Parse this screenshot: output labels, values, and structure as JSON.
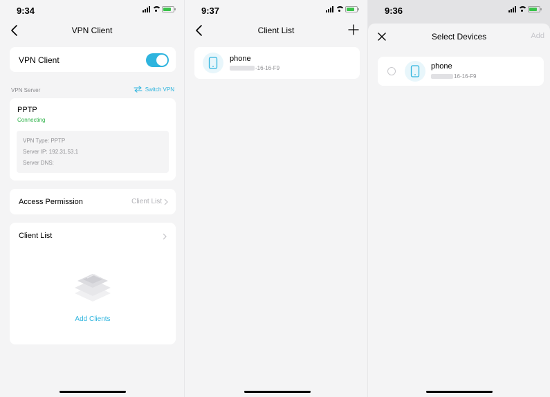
{
  "screen1": {
    "status_time": "9:34",
    "nav_title": "VPN Client",
    "vpn_client_label": "VPN Client",
    "vpn_enabled": true,
    "vpn_server_caption": "VPN Server",
    "switch_vpn_label": "Switch VPN",
    "protocol": "PPTP",
    "status_text": "Connecting",
    "details": {
      "vpn_type": "VPN Type: PPTP",
      "server_ip": "Server IP: 192.31.53.1",
      "server_dns": "Server DNS:"
    },
    "access_permission_label": "Access Permission",
    "access_permission_value": "Client List",
    "client_list_label": "Client List",
    "add_clients_label": "Add Clients"
  },
  "screen2": {
    "status_time": "9:37",
    "nav_title": "Client List",
    "device": {
      "name": "phone",
      "mac_suffix": "-16-16-F9"
    }
  },
  "screen3": {
    "status_time": "9:36",
    "title": "Select Devices",
    "add_label": "Add",
    "device": {
      "name": "phone",
      "mac_suffix": "16-16-F9"
    }
  },
  "colors": {
    "accent": "#2eb4de",
    "connecting": "#2fb34a",
    "background": "#f4f4f5"
  },
  "icons": [
    "back-icon",
    "plus-icon",
    "close-icon",
    "switch-icon",
    "chevron-right-icon",
    "phone-icon",
    "layers-illustration"
  ]
}
